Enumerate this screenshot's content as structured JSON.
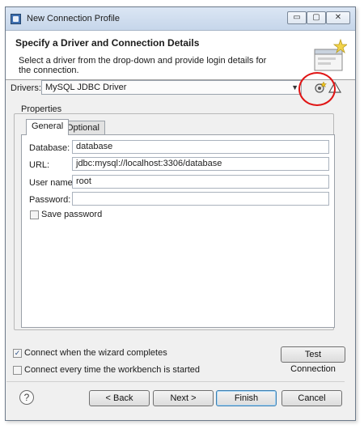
{
  "window": {
    "title": "New Connection Profile",
    "minimize_glyph": "▭",
    "maximize_glyph": "▢",
    "close_glyph": "✕"
  },
  "banner": {
    "title": "Specify a Driver and Connection Details",
    "description": "Select a driver from the drop-down and provide login details for the connection."
  },
  "drivers": {
    "label": "Drivers:",
    "selected": "MySQL JDBC Driver"
  },
  "properties": {
    "group_label": "Properties",
    "tabs": [
      {
        "label": "General",
        "active": true
      },
      {
        "label": "Optional",
        "active": false
      }
    ],
    "fields": [
      {
        "label": "Database:",
        "value": "database"
      },
      {
        "label": "URL:",
        "value": "jdbc:mysql://localhost:3306/database"
      },
      {
        "label": "User name:",
        "value": "root"
      },
      {
        "label": "Password:",
        "value": ""
      }
    ],
    "save_password": {
      "label": "Save password",
      "checked": false
    }
  },
  "options": {
    "connect_when_complete": {
      "label": "Connect when the wizard completes",
      "checked": true
    },
    "connect_every_time": {
      "label": "Connect every time the workbench is started",
      "checked": false
    },
    "test_connection_label": "Test Connection"
  },
  "footer": {
    "help_glyph": "?",
    "back_label": "< Back",
    "next_label": "Next >",
    "finish_label": "Finish",
    "cancel_label": "Cancel"
  },
  "colors": {
    "highlight_ring": "#e01414",
    "default_button_border": "#3c7fb1"
  }
}
